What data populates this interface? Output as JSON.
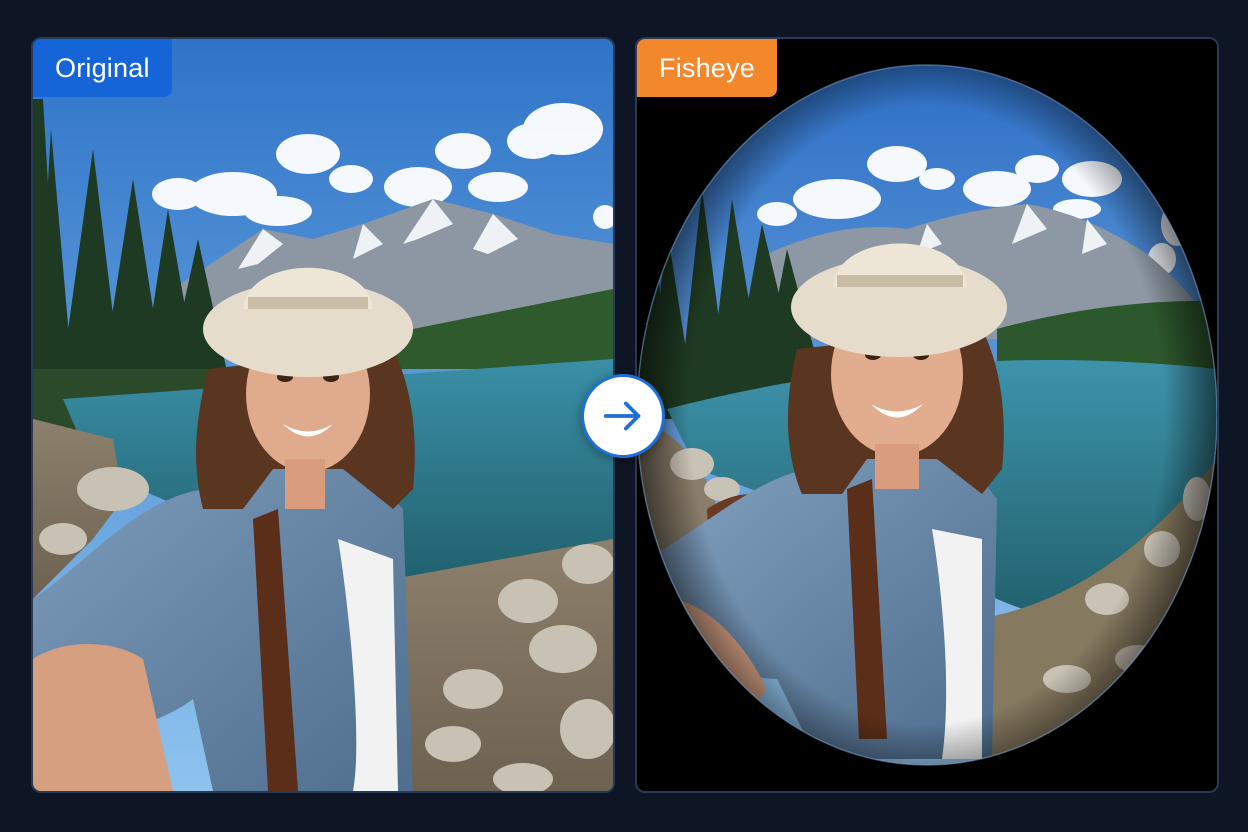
{
  "panels": {
    "left": {
      "label": "Original",
      "accent": "#1565d8"
    },
    "right": {
      "label": "Fisheye",
      "accent": "#f2872c"
    }
  },
  "arrow": {
    "icon": "arrow-right-icon",
    "color": "#1e6fd9"
  },
  "colors": {
    "background": "#0e1626",
    "panel_border": "#2a3a55"
  }
}
